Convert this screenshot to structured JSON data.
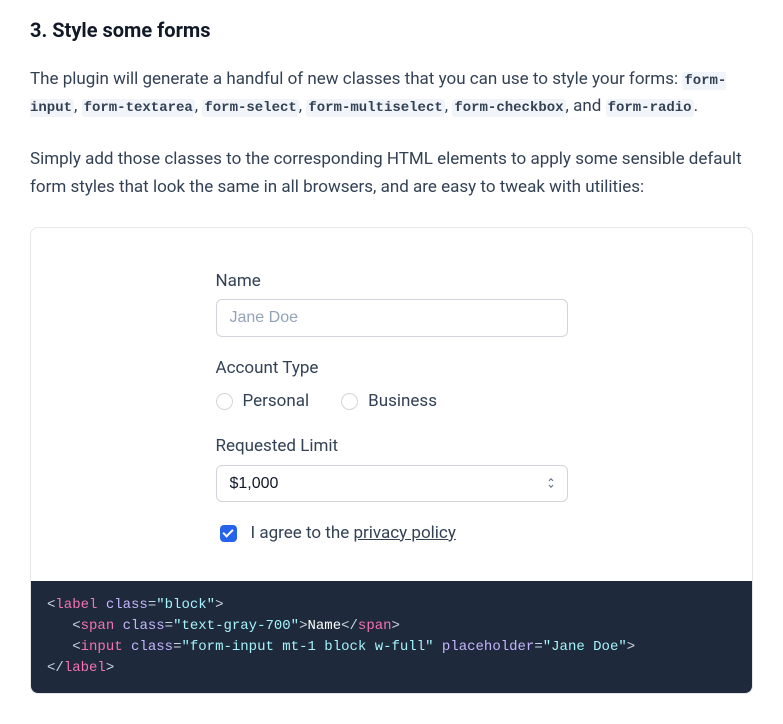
{
  "heading": "3. Style some forms",
  "intro_prefix": "The plugin will generate a handful of new classes that you can use to style your forms: ",
  "classes": [
    "form-input",
    "form-textarea",
    "form-select",
    "form-multiselect",
    "form-checkbox",
    "form-radio"
  ],
  "intro_joiner_and": ", and ",
  "intro_suffix": ".",
  "paragraph2": "Simply add those classes to the corresponding HTML elements to apply some sensible default form styles that look the same in all browsers, and are easy to tweak with utilities:",
  "form": {
    "name_label": "Name",
    "name_placeholder": "Jane Doe",
    "account_type_label": "Account Type",
    "radio_personal": "Personal",
    "radio_business": "Business",
    "limit_label": "Requested Limit",
    "limit_value": "$1,000",
    "agree_prefix": "I agree to the ",
    "agree_link": "privacy policy"
  },
  "code": {
    "l1_tag": "label",
    "l1_attr": "class",
    "l1_val": "\"block\"",
    "l2_tag": "span",
    "l2_attr": "class",
    "l2_val": "\"text-gray-700\"",
    "l2_text": "Name",
    "l3_tag": "input",
    "l3_attr1": "class",
    "l3_val1": "\"form-input mt-1 block w-full\"",
    "l3_attr2": "placeholder",
    "l3_val2": "\"Jane Doe\""
  }
}
